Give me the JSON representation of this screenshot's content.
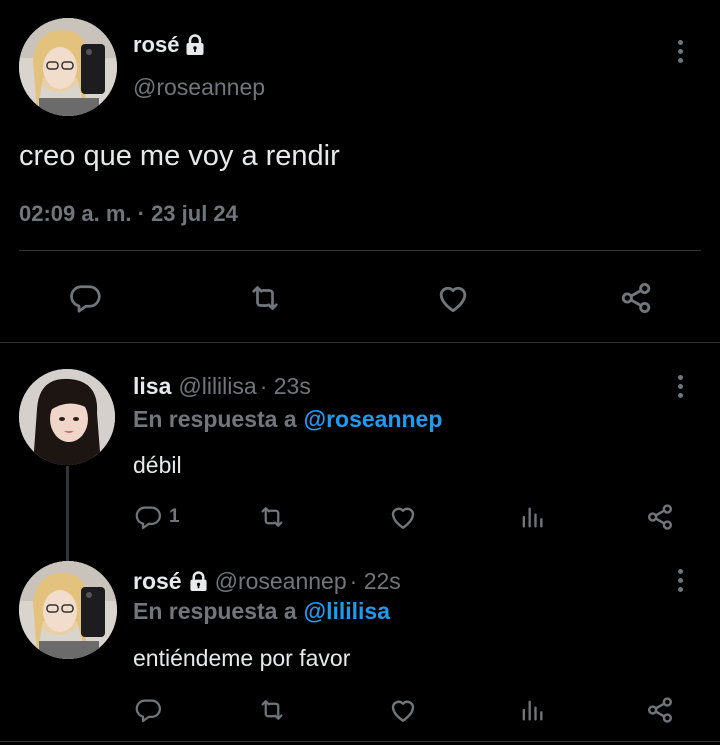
{
  "main_tweet": {
    "author_name": "rosé",
    "handle": "@roseannep",
    "text": "creo que me voy a rendir",
    "timestamp": "02:09 a. m. · 23 jul 24",
    "actions": [
      "reply-icon",
      "retweet-icon",
      "like-icon",
      "share-icon"
    ]
  },
  "replies": [
    {
      "author_name": "lisa",
      "handle": "@lililisa",
      "time": "· 23s",
      "reply_prefix": "En respuesta a",
      "reply_to": "@roseannep",
      "text": "débil",
      "reply_count": "1",
      "actions": [
        "reply-icon",
        "retweet-icon",
        "like-icon",
        "views-icon",
        "share-icon"
      ]
    },
    {
      "author_name": "rosé",
      "handle": "@roseannep",
      "time": "· 22s",
      "reply_prefix": "En respuesta a",
      "reply_to": "@lililisa",
      "text": "entiéndeme por favor",
      "actions": [
        "reply-icon",
        "retweet-icon",
        "like-icon",
        "views-icon",
        "share-icon"
      ]
    }
  ],
  "colors": {
    "background": "#000000",
    "text": "#e7e9ea",
    "muted": "#71767b",
    "link": "#1d9bf0",
    "divider": "#2f3336"
  }
}
